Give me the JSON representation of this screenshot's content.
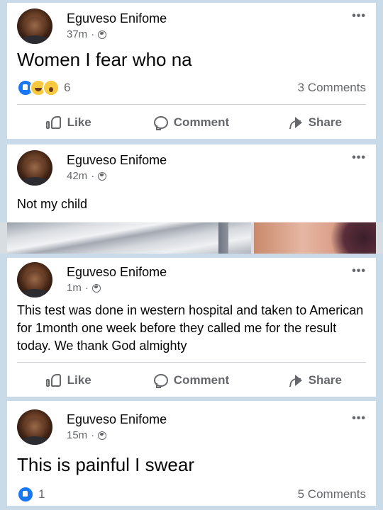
{
  "posts": [
    {
      "author": "Eguveso Enifome",
      "time": "37m",
      "text": "Women I fear who na",
      "reaction_count": "6",
      "comments": "3 Comments"
    },
    {
      "author": "Eguveso Enifome",
      "time": "42m",
      "text": "Not my child"
    },
    {
      "author": "Eguveso Enifome",
      "time": "1m",
      "text": "This test was done in western hospital and taken to American for 1month one week before they called me for the result today. We thank God almighty"
    },
    {
      "author": "Eguveso Enifome",
      "time": "15m",
      "text": "This is painful I swear",
      "reaction_count": "1",
      "comments": "5 Comments"
    }
  ],
  "actions": {
    "like": "Like",
    "comment": "Comment",
    "share": "Share"
  },
  "separator": "·",
  "more_glyph": "•••",
  "icons": [
    "globe-icon",
    "more-options-icon",
    "like-reaction-icon",
    "haha-reaction-icon",
    "wow-reaction-icon",
    "like-icon",
    "comment-icon",
    "share-icon"
  ],
  "colors": {
    "background": "#c9dbe9",
    "card": "#ffffff",
    "text": "#050505",
    "muted": "#65676b",
    "like_blue": "#1877f2",
    "divider": "#ced0d4"
  }
}
